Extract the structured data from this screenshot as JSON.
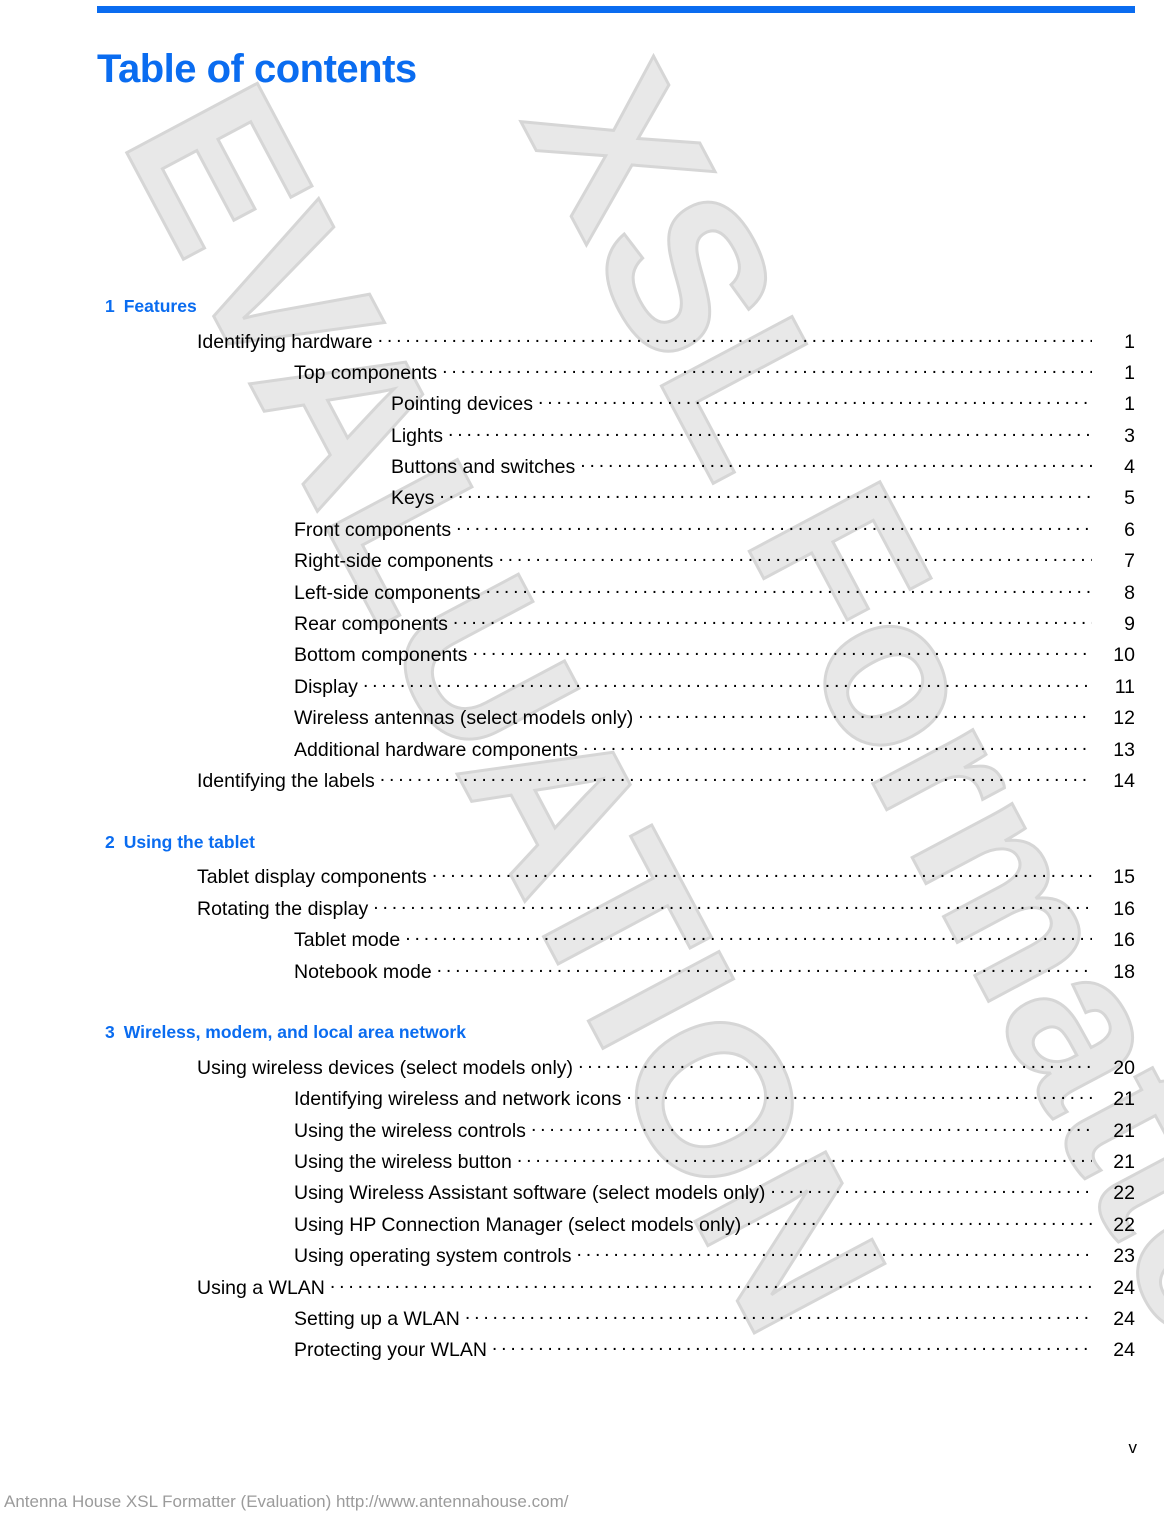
{
  "document": {
    "title": "Table of contents",
    "folio": "v",
    "accent_color": "#0a6cf0",
    "watermark_lines": [
      "EVALUATION",
      "XSL Formatter"
    ]
  },
  "footer": {
    "evaluation_notice": "Antenna House XSL Formatter (Evaluation)  http://www.antennahouse.com/"
  },
  "chapters": [
    {
      "number": "1",
      "title": "Features",
      "entries": [
        {
          "level": 1,
          "label": "Identifying hardware",
          "page": "1"
        },
        {
          "level": 2,
          "label": "Top components",
          "page": "1"
        },
        {
          "level": 3,
          "label": "Pointing devices",
          "page": "1"
        },
        {
          "level": 3,
          "label": "Lights",
          "page": "3"
        },
        {
          "level": 3,
          "label": "Buttons and switches",
          "page": "4"
        },
        {
          "level": 3,
          "label": "Keys",
          "page": "5"
        },
        {
          "level": 2,
          "label": "Front components",
          "page": "6"
        },
        {
          "level": 2,
          "label": "Right-side components",
          "page": "7"
        },
        {
          "level": 2,
          "label": "Left-side components",
          "page": "8"
        },
        {
          "level": 2,
          "label": "Rear components",
          "page": "9"
        },
        {
          "level": 2,
          "label": "Bottom components",
          "page": "10"
        },
        {
          "level": 2,
          "label": "Display",
          "page": "11"
        },
        {
          "level": 2,
          "label": "Wireless antennas (select models only)",
          "page": "12"
        },
        {
          "level": 2,
          "label": "Additional hardware components",
          "page": "13"
        },
        {
          "level": 1,
          "label": "Identifying the labels",
          "page": "14"
        }
      ]
    },
    {
      "number": "2",
      "title": "Using the tablet",
      "entries": [
        {
          "level": 1,
          "label": "Tablet display components",
          "page": "15"
        },
        {
          "level": 1,
          "label": "Rotating the display",
          "page": "16"
        },
        {
          "level": 2,
          "label": "Tablet mode",
          "page": "16"
        },
        {
          "level": 2,
          "label": "Notebook mode ",
          "page": "18"
        }
      ]
    },
    {
      "number": "3",
      "title": "Wireless, modem, and local area network",
      "entries": [
        {
          "level": 1,
          "label": "Using wireless devices (select models only)",
          "page": "20"
        },
        {
          "level": 2,
          "label": "Identifying wireless and network icons",
          "page": "21"
        },
        {
          "level": 2,
          "label": "Using the wireless controls",
          "page": "21"
        },
        {
          "level": 2,
          "label": "Using the wireless button",
          "page": "21"
        },
        {
          "level": 2,
          "label": "Using Wireless Assistant software (select models only)",
          "page": "22"
        },
        {
          "level": 2,
          "label": "Using HP Connection Manager (select models only)",
          "page": "22"
        },
        {
          "level": 2,
          "label": "Using operating system controls",
          "page": "23"
        },
        {
          "level": 1,
          "label": "Using a WLAN",
          "page": "24"
        },
        {
          "level": 2,
          "label": "Setting up a WLAN",
          "page": "24"
        },
        {
          "level": 2,
          "label": "Protecting your WLAN",
          "page": "24"
        }
      ]
    }
  ]
}
